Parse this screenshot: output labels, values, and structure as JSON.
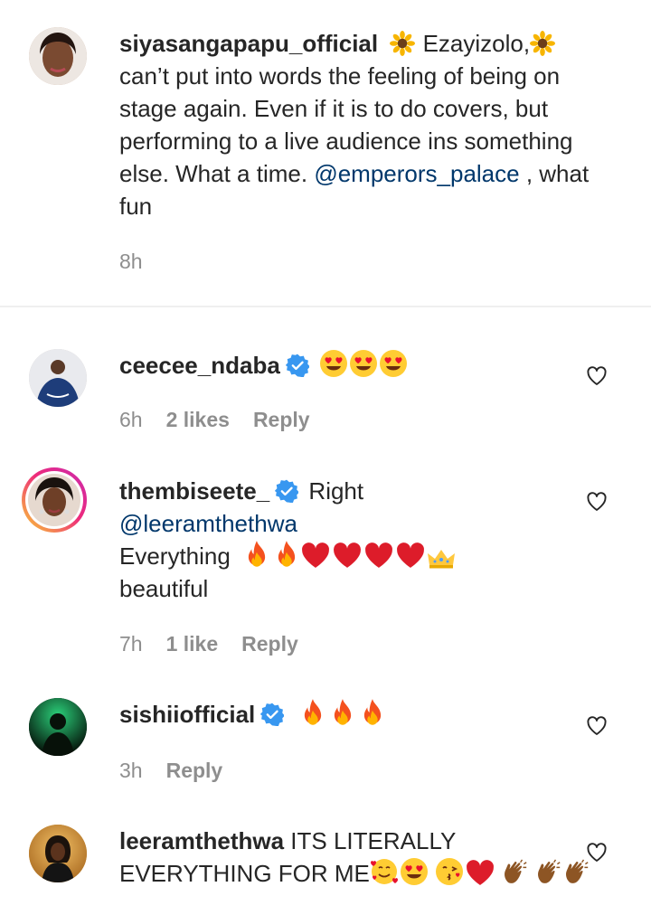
{
  "caption": {
    "username": "siyasangapapu_official",
    "text_1": " Ezayizolo,",
    "text_2": " can’t put into words the feeling of being on stage again. Even if it is to do covers, but performing to a live audience ins something else. What a time. ",
    "mention": "@emperors_palace",
    "text_3": " , what fun",
    "time": "8h"
  },
  "comments": [
    {
      "username": "ceecee_ndaba",
      "verified": true,
      "text": "",
      "emojis": [
        "heart-eyes-emoji",
        "heart-eyes-emoji",
        "heart-eyes-emoji"
      ],
      "time": "6h",
      "likes": "2 likes",
      "reply": "Reply"
    },
    {
      "username": "thembiseete_",
      "verified": true,
      "text_1": " Right",
      "mention": "@leeramthethwa",
      "text_2": "Everything",
      "text_3": "beautiful",
      "emojis": [
        "fire-emoji",
        "fire-emoji",
        "red-heart-emoji",
        "red-heart-emoji",
        "red-heart-emoji",
        "red-heart-emoji",
        "crown-emoji"
      ],
      "time": "7h",
      "likes": "1 like",
      "reply": "Reply"
    },
    {
      "username": "sishiiofficial",
      "verified": true,
      "text": "",
      "emojis": [
        "fire-emoji",
        "fire-emoji",
        "fire-emoji"
      ],
      "time": "3h",
      "reply": "Reply"
    },
    {
      "username": "leeramthethwa",
      "verified": false,
      "text": " ITS LITERALLY EVERYTHING FOR ME",
      "emojis": [
        "smiling-hearts-emoji",
        "heart-eyes-emoji",
        "kiss-emoji",
        "red-heart-emoji",
        "clap-emoji",
        "clap-emoji",
        "clap-emoji"
      ]
    }
  ],
  "colors": {
    "text": "#262626",
    "meta": "#8e8e8e",
    "mention": "#00376b",
    "verified": "#3897f0",
    "divider": "#efefef"
  }
}
